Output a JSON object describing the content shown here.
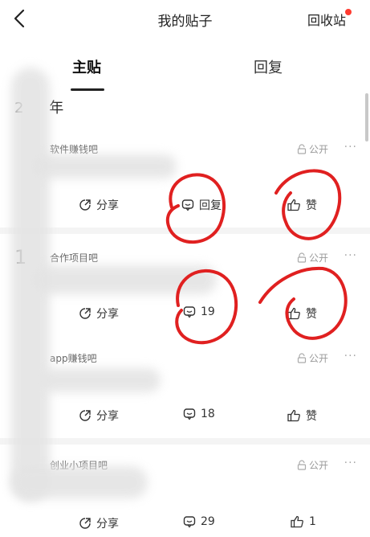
{
  "header": {
    "title": "我的贴子",
    "recycle_label": "回收站"
  },
  "tabs": [
    {
      "label": "主贴"
    },
    {
      "label": "回复"
    }
  ],
  "section_labels": [
    "2",
    "年",
    "1"
  ],
  "posts": [
    {
      "forum": "软件赚钱吧",
      "visibility": "公开",
      "share": "分享",
      "reply": "回复",
      "like": "赞"
    },
    {
      "forum": "合作项目吧",
      "visibility": "公开",
      "share": "分享",
      "reply": "19",
      "like": "赞"
    },
    {
      "forum": "app赚钱吧",
      "visibility": "公开",
      "share": "分享",
      "reply": "18",
      "like": "赞"
    },
    {
      "forum": "创业小项目吧",
      "visibility": "公开",
      "share": "分享",
      "reply": "29",
      "like": "1"
    }
  ],
  "colors": {
    "annotation": "#e02020",
    "badge": "#ff3b30"
  },
  "icons": [
    "back-arrow-icon",
    "lock-icon",
    "more-icon",
    "share-icon",
    "comment-icon",
    "thumbs-up-icon"
  ]
}
